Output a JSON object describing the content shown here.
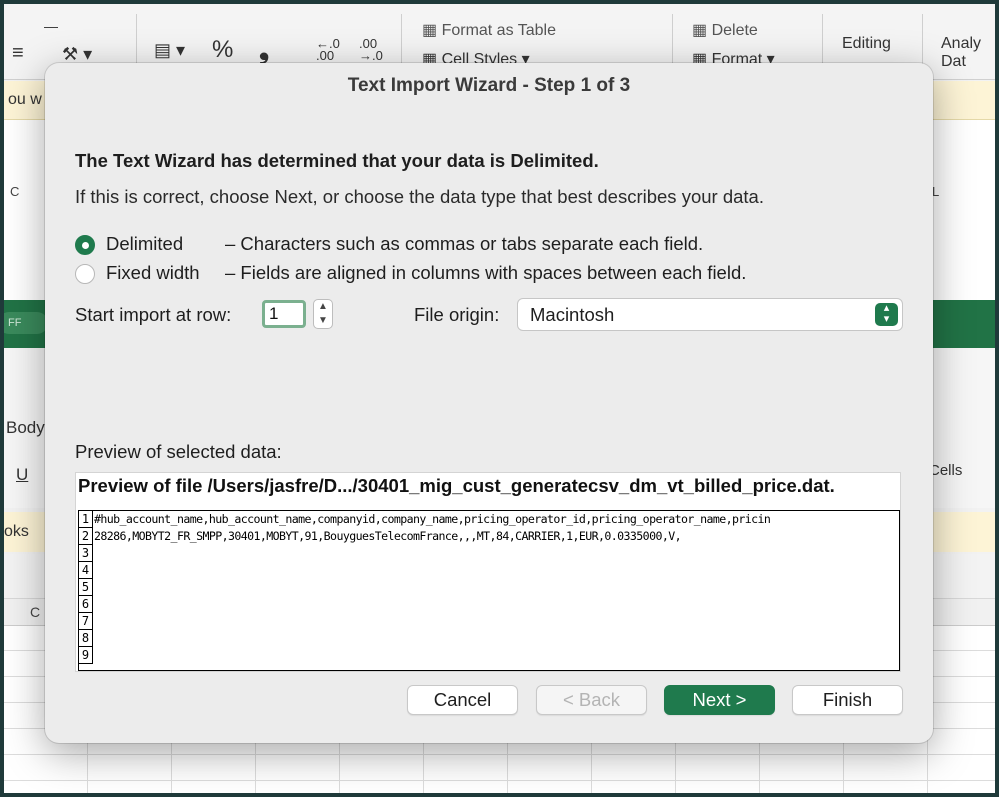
{
  "background": {
    "ribbon": {
      "format_as_table": "Format as Table",
      "cell_styles": "Cell Styles",
      "delete": "Delete",
      "format": "Format",
      "editing": "Editing",
      "analyze_data": "Analy\nDat",
      "percent_symbol": "%",
      "comma_symbol": "ʺ"
    },
    "notice_fragment": "ou w",
    "green_pill": "FF",
    "body_fragment": "Body",
    "underline_fragment": "U",
    "cells_fragment": "Cells",
    "notice2_fragment": "oks",
    "col_c": "C",
    "col_c2": "C",
    "col_l": "L"
  },
  "dialog": {
    "title": "Text Import Wizard - Step 1 of 3",
    "headline": "The Text Wizard has determined that your data is Delimited.",
    "subline": "If this is correct, choose Next, or choose the data type that best describes your data.",
    "options": [
      {
        "label": "Delimited",
        "desc": "– Characters such as commas or tabs separate each field.",
        "selected": true
      },
      {
        "label": "Fixed width",
        "desc": "– Fields are aligned in columns with spaces between each field.",
        "selected": false
      }
    ],
    "start_row_label": "Start import at row:",
    "start_row_value": "1",
    "file_origin_label": "File origin:",
    "file_origin_value": "Macintosh",
    "preview_label": "Preview of selected data:",
    "preview_file": "Preview of file /Users/jasfre/D.../30401_mig_cust_generatecsv_dm_vt_billed_price.dat.",
    "preview_rows": [
      {
        "num": "1",
        "text": "#hub_account_name,hub_account_name,companyid,company_name,pricing_operator_id,pricing_operator_name,pricin"
      },
      {
        "num": "2",
        "text": "28286,MOBYT2_FR_SMPP,30401,MOBYT,91,BouyguesTelecomFrance,,,MT,84,CARRIER,1,EUR,0.0335000,V,"
      },
      {
        "num": "3",
        "text": ""
      },
      {
        "num": "4",
        "text": ""
      },
      {
        "num": "5",
        "text": ""
      },
      {
        "num": "6",
        "text": ""
      },
      {
        "num": "7",
        "text": ""
      },
      {
        "num": "8",
        "text": ""
      },
      {
        "num": "9",
        "text": ""
      }
    ],
    "buttons": {
      "cancel": "Cancel",
      "back": "< Back",
      "next": "Next >",
      "finish": "Finish"
    }
  },
  "colors": {
    "accent_green": "#1f7a4d",
    "excel_green": "#217346",
    "notice_yellow": "#fdf4d6"
  }
}
